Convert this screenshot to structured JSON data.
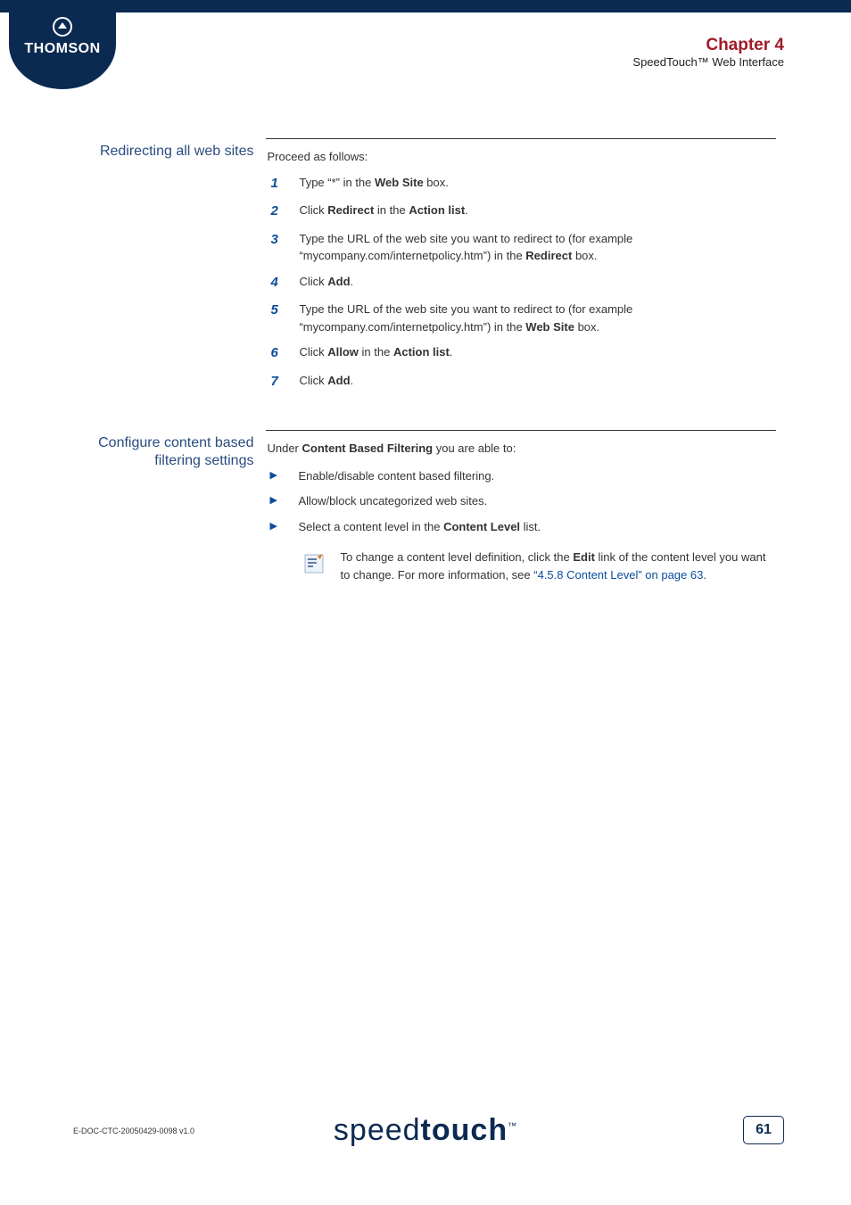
{
  "brand": {
    "name": "THOMSON"
  },
  "header": {
    "chapter": "Chapter 4",
    "subtitle": "SpeedTouch™ Web Interface"
  },
  "section1": {
    "heading": "Redirecting all web sites",
    "intro": "Proceed as follows:",
    "steps": [
      {
        "num": "1",
        "pre": "Type “*” in the ",
        "bold": "Web Site",
        "post": " box."
      },
      {
        "num": "2",
        "pre": "Click ",
        "bold": "Redirect",
        "mid": " in the ",
        "bold2": "Action list",
        "post": "."
      },
      {
        "num": "3",
        "pre": "Type the URL of the web site you want to redirect to (for example “mycompany.com/internetpolicy.htm”) in the ",
        "bold": "Redirect",
        "post": " box."
      },
      {
        "num": "4",
        "pre": "Click ",
        "bold": "Add",
        "post": "."
      },
      {
        "num": "5",
        "pre": "Type the URL of the web site you want to redirect to (for example “mycompany.com/internetpolicy.htm”) in the ",
        "bold": "Web Site",
        "post": " box."
      },
      {
        "num": "6",
        "pre": "Click ",
        "bold": "Allow",
        "mid": " in the ",
        "bold2": "Action list",
        "post": "."
      },
      {
        "num": "7",
        "pre": "Click ",
        "bold": "Add",
        "post": "."
      }
    ]
  },
  "section2": {
    "heading": "Configure content based filtering settings",
    "intro_pre": "Under ",
    "intro_bold": "Content Based Filtering",
    "intro_post": " you are able to:",
    "bullets": [
      {
        "text": "Enable/disable content based filtering."
      },
      {
        "text": "Allow/block uncategorized web sites."
      },
      {
        "pre": "Select a content level in the ",
        "bold": "Content Level",
        "post": " list."
      }
    ],
    "note": {
      "pre": "To change a content level definition, click the ",
      "bold": "Edit",
      "mid": " link of the content level you want to change. For more information, see ",
      "xref": "“4.5.8 Content Level” on page 63",
      "post": "."
    }
  },
  "footer": {
    "docid": "E-DOC-CTC-20050429-0098 v1.0",
    "product_thin": "speed",
    "product_bold": "touch",
    "page": "61"
  }
}
